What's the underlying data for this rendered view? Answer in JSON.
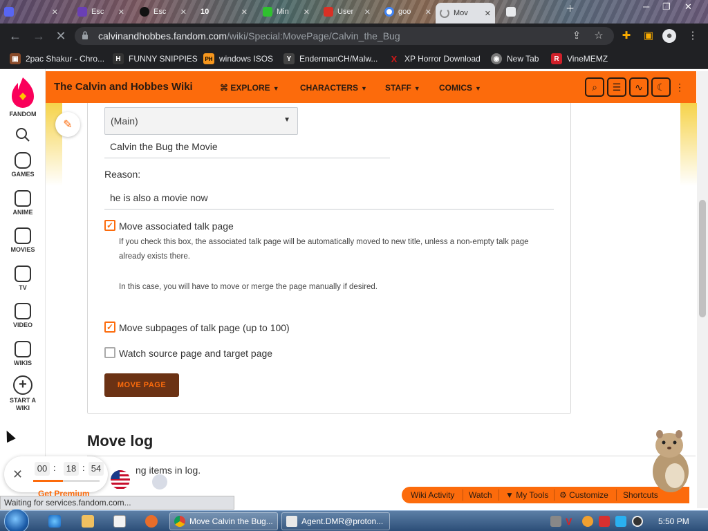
{
  "browser": {
    "tabs": [
      {
        "label": "",
        "icon_color": "#5865f2"
      },
      {
        "label": "Esc",
        "icon_color": "#6a3fb5"
      },
      {
        "label": "Esc",
        "icon_color": "#111111"
      },
      {
        "label": "10",
        "icon_color": "#222222"
      },
      {
        "label": "Min",
        "icon_color": "#2fc12f"
      },
      {
        "label": "User",
        "icon_color": "#d93025"
      },
      {
        "label": "goo",
        "icon_color": "#4285f4"
      },
      {
        "label": "Mov",
        "icon_color": "#fc6b0c"
      },
      {
        "label": "",
        "icon_color": "#e8eaed"
      }
    ],
    "url_host": "calvinandhobbes.fandom.com",
    "url_path": "/wiki/Special:MovePage/Calvin_the_Bug",
    "bookmarks": [
      {
        "label": "2pac Shakur - Chro...",
        "icon": "▣",
        "color": "#8a4b2a"
      },
      {
        "label": "FUNNY SNIPPIES",
        "icon": "H",
        "color": "#333333"
      },
      {
        "label": "windows ISOS",
        "icon": "PH",
        "color": "#f7971d"
      },
      {
        "label": "EndermanCH/Malw...",
        "icon": "Y",
        "color": "#444444"
      },
      {
        "label": "XP Horror Download",
        "icon": "X",
        "color": "#d01818"
      },
      {
        "label": "New Tab",
        "icon": "◉",
        "color": "#7a7a7a"
      },
      {
        "label": "VineMEMZ",
        "icon": "R",
        "color": "#d0202a"
      }
    ]
  },
  "rail": {
    "brand": "FANDOM",
    "items": [
      {
        "label": "GAMES"
      },
      {
        "label": "ANIME"
      },
      {
        "label": "MOVIES"
      },
      {
        "label": "TV"
      },
      {
        "label": "VIDEO"
      },
      {
        "label": "WIKIS"
      },
      {
        "label": "START A WIKI"
      }
    ]
  },
  "wiki": {
    "title": "The Calvin and Hobbes Wiki",
    "nav": [
      "EXPLORE",
      "CHARACTERS",
      "STAFF",
      "COMICS"
    ]
  },
  "form": {
    "namespace": "(Main)",
    "new_title": "Calvin the Bug the Movie",
    "reason_label": "Reason:",
    "reason_value": "he is also a movie now",
    "talk_label": "Move associated talk page",
    "talk_checked": true,
    "talk_help_1": "If you check this box, the associated talk page will be automatically moved to new title, unless a non-empty talk page already exists there.",
    "talk_help_2": "In this case, you will have to move or merge the page manually if desired.",
    "subpages_label": "Move subpages of talk page (up to 100)",
    "subpages_checked": true,
    "watch_label": "Watch source page and target page",
    "watch_checked": false,
    "submit_label": "MOVE PAGE"
  },
  "movelog": {
    "heading": "Move log",
    "text": "ng items in log."
  },
  "timer": {
    "hh": "00",
    "mm": "18",
    "ss": "54",
    "progress": 0.45,
    "premium_label": "Get Premium"
  },
  "status_text": "Waiting for services.fandom.com...",
  "wiki_tools": [
    "Wiki Activity",
    "Watch",
    "My Tools",
    "Customize",
    "Shortcuts"
  ],
  "taskbar": {
    "tasks": [
      {
        "label": "Move Calvin the Bug..."
      },
      {
        "label": "Agent.DMR@proton..."
      }
    ],
    "clock": "5:50 PM"
  },
  "colors": {
    "fandom_orange": "#fc6b0c",
    "button_dark": "#6b3214"
  }
}
